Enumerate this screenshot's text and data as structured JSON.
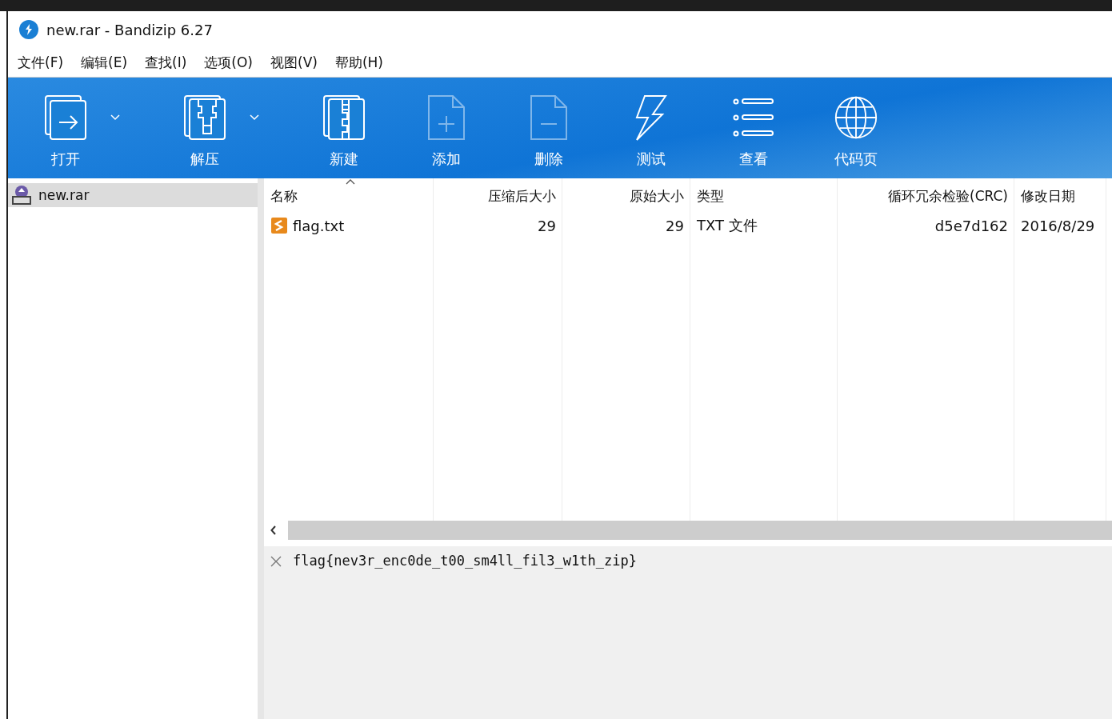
{
  "window": {
    "title": "new.rar - Bandizip 6.27"
  },
  "menu": [
    "文件(F)",
    "编辑(E)",
    "查找(I)",
    "选项(O)",
    "视图(V)",
    "帮助(H)"
  ],
  "toolbar": [
    {
      "kind": "open",
      "label": "打开",
      "dropdown": true,
      "disabled": false
    },
    {
      "kind": "extract",
      "label": "解压",
      "dropdown": true,
      "disabled": false
    },
    {
      "kind": "new",
      "label": "新建",
      "dropdown": false,
      "disabled": false
    },
    {
      "kind": "add",
      "label": "添加",
      "dropdown": false,
      "disabled": true
    },
    {
      "kind": "delete",
      "label": "删除",
      "dropdown": false,
      "disabled": true
    },
    {
      "kind": "test",
      "label": "测试",
      "dropdown": false,
      "disabled": false
    },
    {
      "kind": "view",
      "label": "查看",
      "dropdown": false,
      "disabled": false
    },
    {
      "kind": "codepage",
      "label": "代码页",
      "dropdown": false,
      "disabled": false
    }
  ],
  "sidebar": {
    "items": [
      {
        "label": "new.rar",
        "selected": true
      }
    ]
  },
  "table": {
    "columns": [
      {
        "label": "名称",
        "sorted": true
      },
      {
        "label": "压缩后大小",
        "sorted": false
      },
      {
        "label": "原始大小",
        "sorted": false
      },
      {
        "label": "类型",
        "sorted": false
      },
      {
        "label": "循环冗余检验(CRC)",
        "sorted": false
      },
      {
        "label": "修改日期",
        "sorted": false
      }
    ],
    "rows": [
      {
        "selected": false,
        "cells": [
          "flag.txt",
          "29",
          "29",
          "TXT 文件",
          "d5e7d162",
          "2016/8/29"
        ]
      }
    ]
  },
  "comment": {
    "text": "flag{nev3r_enc0de_t00_sm4ll_fil3_w1th_zip}"
  }
}
